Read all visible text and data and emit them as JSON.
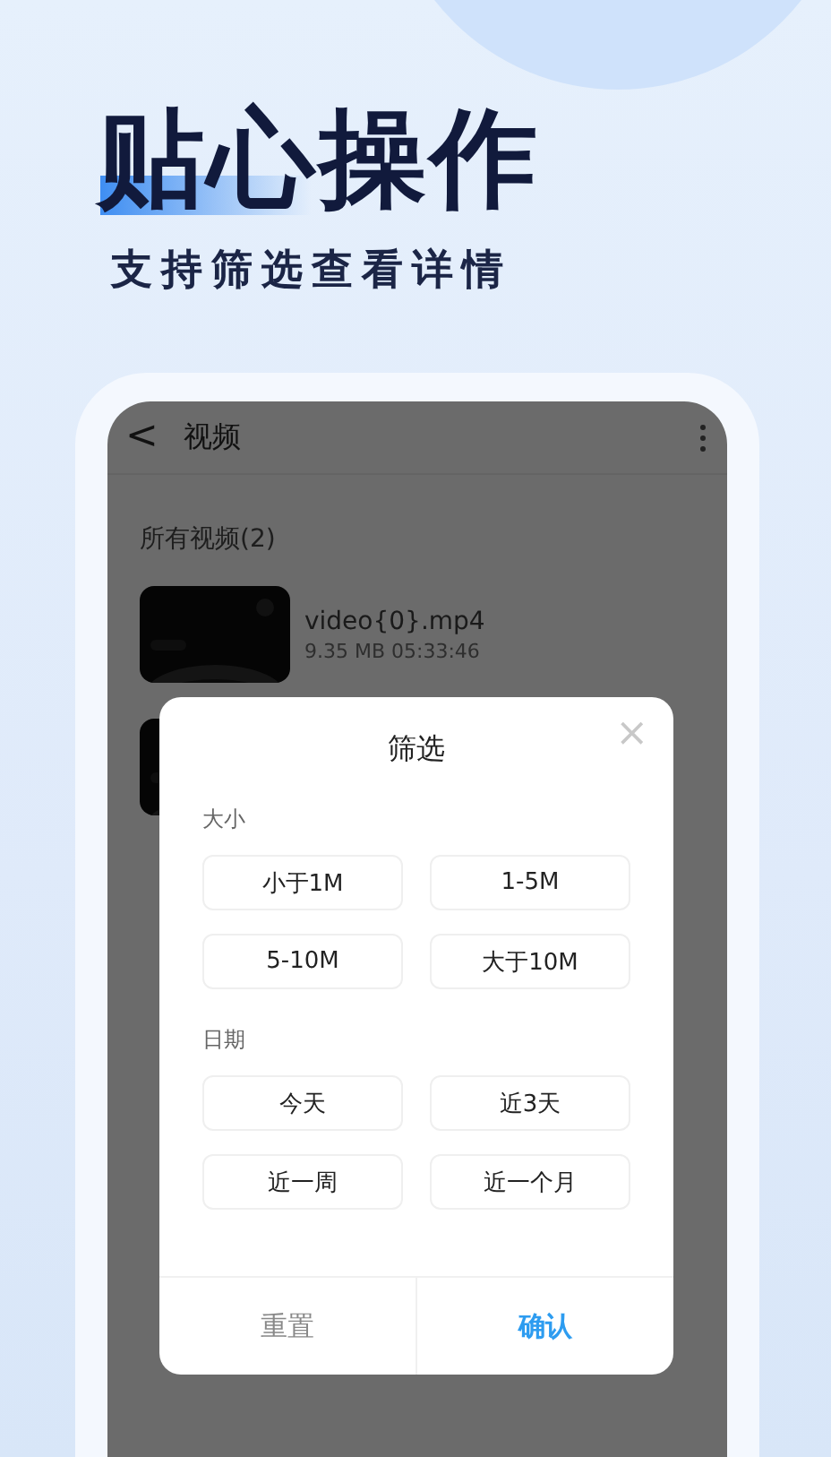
{
  "headline": "贴心操作",
  "subtitle": "支持筛选查看详情",
  "app_bar": {
    "back": "<",
    "title": "视频"
  },
  "list_header": "所有视频(2)",
  "videos": [
    {
      "kind": "picture",
      "name": "video{0}.mp4",
      "meta": "9.35 MB 05:33:46"
    },
    {
      "kind": "picture"
    }
  ],
  "dialog": {
    "title": "筛选",
    "close": "×",
    "sections": [
      {
        "label": "大小",
        "options": [
          {
            "label": "小于1M",
            "selected": false
          },
          {
            "label": "1-5M",
            "selected": false
          },
          {
            "label": "5-10M",
            "selected": false
          },
          {
            "label": "大于10M",
            "selected": false
          }
        ]
      },
      {
        "label": "日期",
        "options": [
          {
            "label": "今天",
            "selected": false
          },
          {
            "label": "近3天",
            "selected": false
          },
          {
            "label": "近一周",
            "selected": false
          },
          {
            "label": "近一个月",
            "selected": false
          }
        ]
      }
    ],
    "buttons": [
      {
        "label": "重置",
        "kind": "secondary"
      },
      {
        "label": "确认",
        "kind": "primary"
      }
    ]
  }
}
